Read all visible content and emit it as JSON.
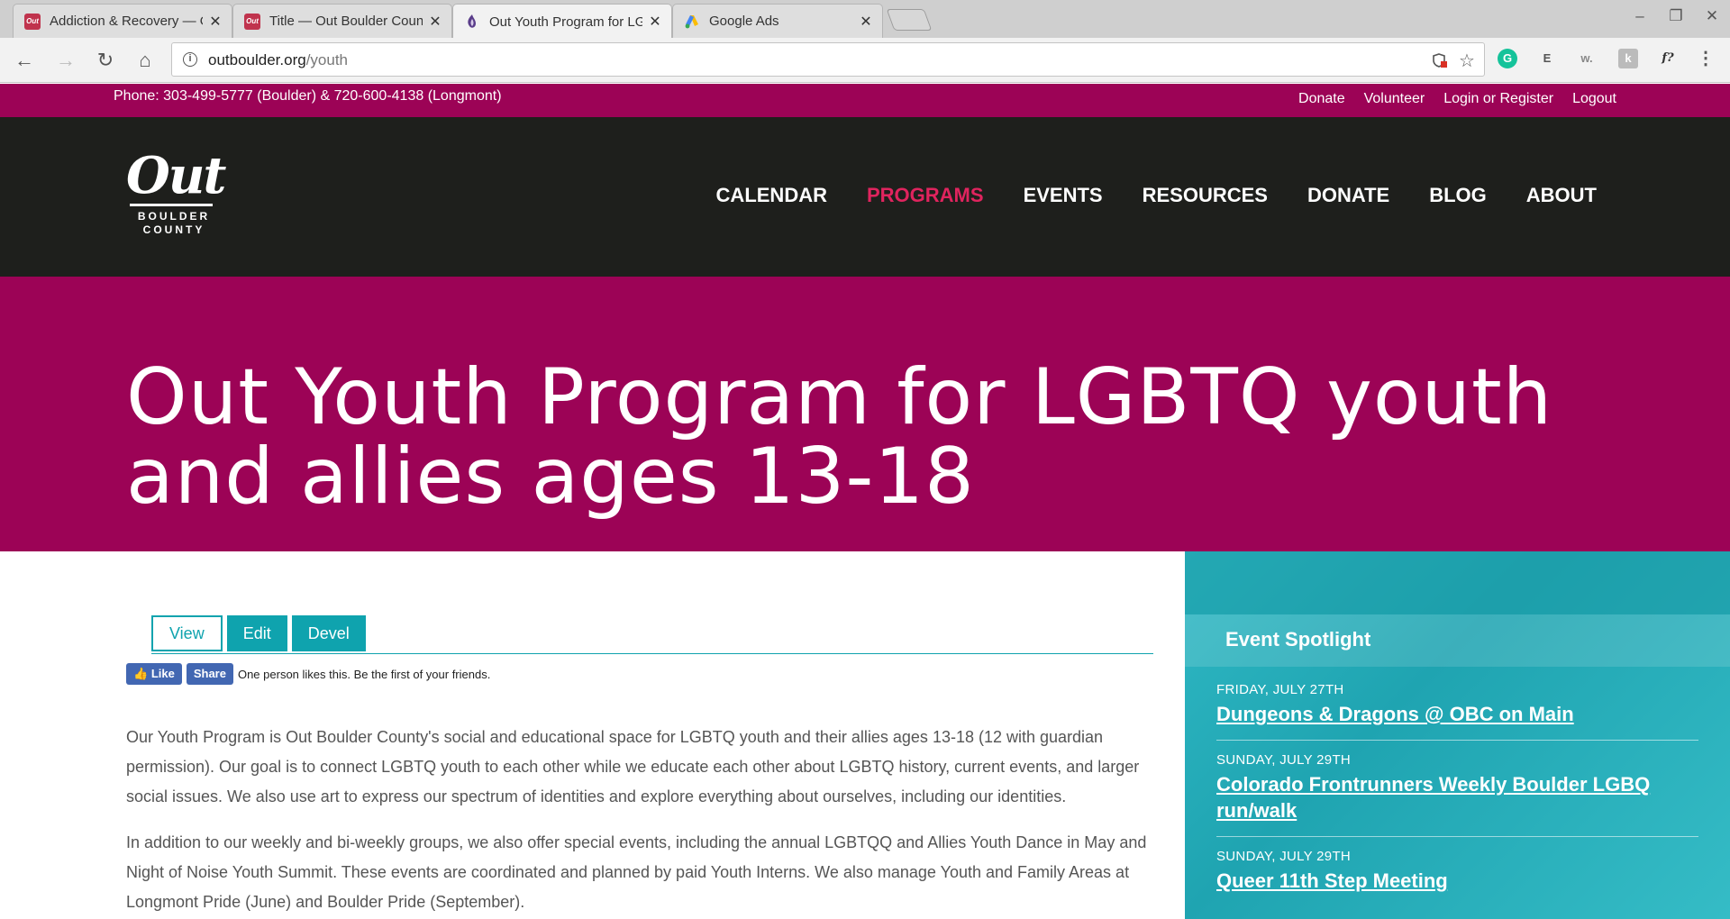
{
  "browser": {
    "tabs": [
      {
        "title": "Addiction & Recovery — O",
        "favicon": "out-boulder-favicon",
        "active": false
      },
      {
        "title": "Title — Out Boulder Coun",
        "favicon": "out-boulder-favicon",
        "active": false
      },
      {
        "title": "Out Youth Program for LG",
        "favicon": "out-youth-favicon",
        "active": true
      },
      {
        "title": "Google Ads",
        "favicon": "google-ads-favicon",
        "active": false
      }
    ],
    "close_glyph": "✕",
    "url_domain": "outboulder.org",
    "url_path": "/youth",
    "nav": {
      "back": "←",
      "forward": "→",
      "reload": "↻",
      "home": "⌂"
    },
    "window_controls": {
      "minimize": "–",
      "restore": "❐",
      "close": "✕"
    },
    "extensions": [
      {
        "name": "grammarly-icon",
        "glyph": "G",
        "color": "#15c39a"
      },
      {
        "name": "evernote-icon",
        "glyph": "E",
        "color": "#555555"
      },
      {
        "name": "wordtune-icon",
        "glyph": "w.",
        "color": "#888888"
      },
      {
        "name": "extension-icon",
        "glyph": "k",
        "color": "#999999"
      },
      {
        "name": "fontface-icon",
        "glyph": "f?",
        "color": "#333333"
      },
      {
        "name": "menu-icon",
        "glyph": "⋮",
        "color": "#555555"
      }
    ]
  },
  "site": {
    "topbar": {
      "phone": "Phone: 303-499-5777 (Boulder) & 720-600-4138 (Longmont)",
      "links": [
        "Donate",
        "Volunteer",
        "Login or Register",
        "Logout"
      ]
    },
    "logo": {
      "script": "Out",
      "line1": "BOULDER",
      "line2": "COUNTY"
    },
    "menu": [
      {
        "label": "CALENDAR",
        "active": false
      },
      {
        "label": "PROGRAMS",
        "active": true
      },
      {
        "label": "EVENTS",
        "active": false
      },
      {
        "label": "RESOURCES",
        "active": false
      },
      {
        "label": "DONATE",
        "active": false
      },
      {
        "label": "BLOG",
        "active": false
      },
      {
        "label": "ABOUT",
        "active": false
      }
    ],
    "hero_title": "Out Youth Program for LGBTQ youth and allies ages 13-18",
    "admin_tabs": [
      "View",
      "Edit",
      "Devel"
    ],
    "facebook": {
      "like": "Like",
      "share": "Share",
      "text": "One person likes this. Be the first of your friends."
    },
    "paragraphs": [
      "Our Youth Program is Out Boulder County's social and educational space for LGBTQ youth and their allies ages 13-18 (12 with guardian permission). Our goal is to connect LGBTQ youth to each other while we educate each other about LGBTQ history, current events, and larger social issues.  We also use art to express our spectrum of identities and explore everything about ourselves, including our identities.",
      "In addition to our weekly and bi-weekly groups, we also offer special events, including the annual LGBTQQ and Allies Youth Dance in May and Night of Noise Youth Summit. These events are coordinated and planned by paid Youth Interns.  We also manage Youth and Family Areas at Longmont Pride (June) and Boulder Pride (September)."
    ],
    "sidebar": {
      "heading": "Event Spotlight",
      "events": [
        {
          "date": "FRIDAY, JULY 27TH",
          "title": "Dungeons & Dragons @ OBC on Main"
        },
        {
          "date": "SUNDAY, JULY 29TH",
          "title": "Colorado Frontrunners Weekly Boulder LGBQ run/walk"
        },
        {
          "date": "SUNDAY, JULY 29TH",
          "title": "Queer 11th Step Meeting"
        }
      ]
    }
  },
  "colors": {
    "brand_magenta": "#9c0356",
    "nav_dark": "#1e1f1c",
    "accent_pink": "#e0245e",
    "teal": "#0fa3ae"
  }
}
